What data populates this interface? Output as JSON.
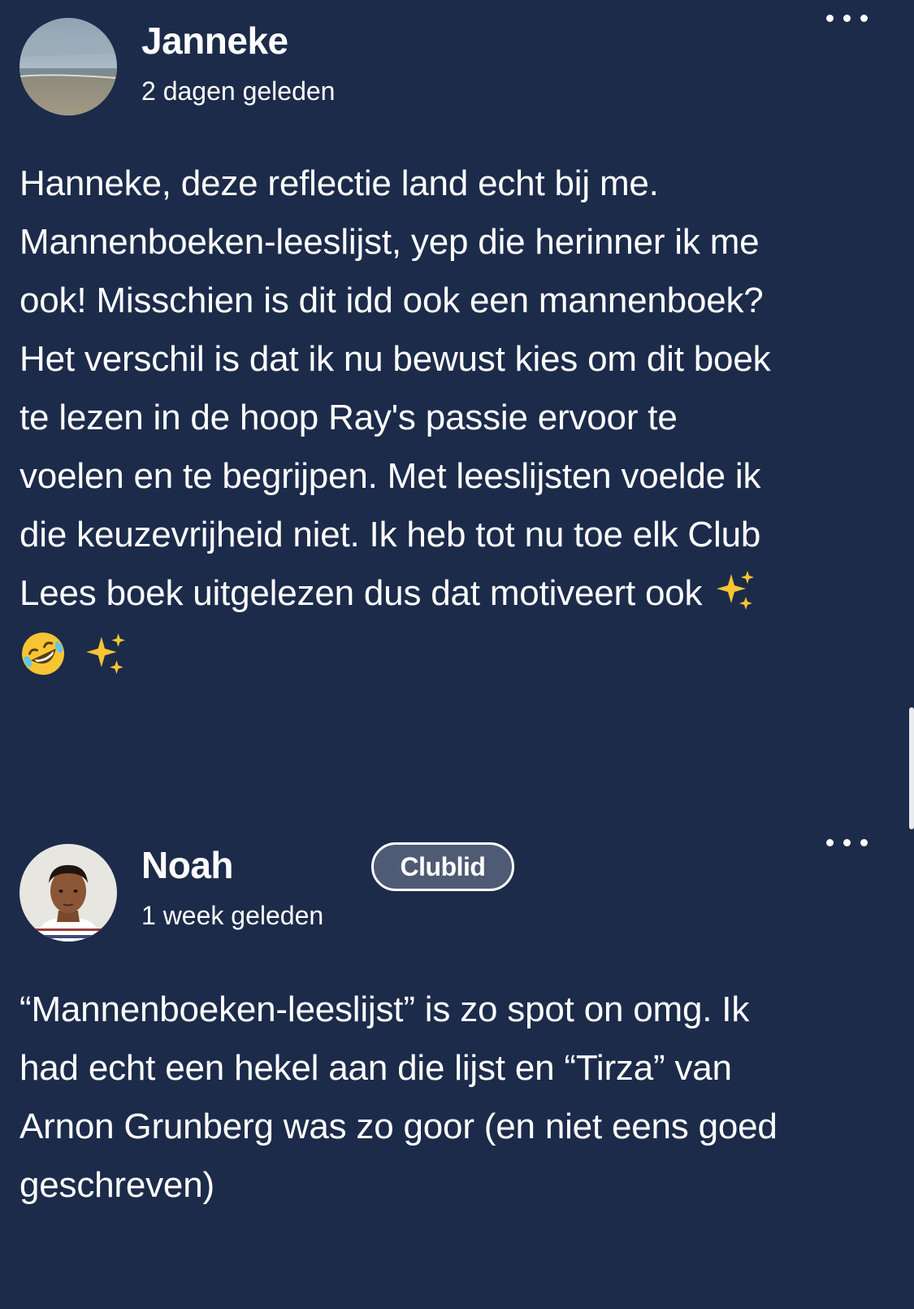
{
  "comments": [
    {
      "author": "Janneke",
      "timestamp": "2 dagen geleden",
      "avatar_icon": "beach-photo-avatar",
      "more_icon": "more-dots-icon",
      "text_lines": [
        "Hanneke, deze reflectie land echt bij me.",
        "Mannenboeken-leeslijst, yep die herinner ik me",
        "ook! Misschien is dit idd ook een mannenboek?",
        "Het verschil is dat ik nu bewust kies om dit boek",
        "te lezen in de hoop Ray's passie ervoor te",
        "voelen en te begrijpen. Met leeslijsten voelde ik",
        "die keuzevrijheid niet. Ik heb tot nu toe elk Club",
        "Lees boek uitgelezen dus dat motiveert ook"
      ],
      "emojis": [
        "sparkles-icon",
        "rolling-laughing-face-icon",
        "sparkles-icon"
      ]
    },
    {
      "author": "Noah",
      "badge": "Clublid",
      "timestamp": "1 week geleden",
      "avatar_icon": "portrait-photo-avatar",
      "more_icon": "more-dots-icon",
      "text_lines": [
        "“Mannenboeken-leeslijst” is zo spot on omg. Ik",
        "had echt een hekel aan die lijst en “Tirza” van",
        "Arnon Grunberg was zo goor (en niet eens goed",
        "geschreven)"
      ]
    }
  ],
  "colors": {
    "background": "#1c2b4a",
    "text": "#ffffff",
    "badge_fill": "#4f5b74",
    "emoji_yellow": "#f7c533"
  }
}
